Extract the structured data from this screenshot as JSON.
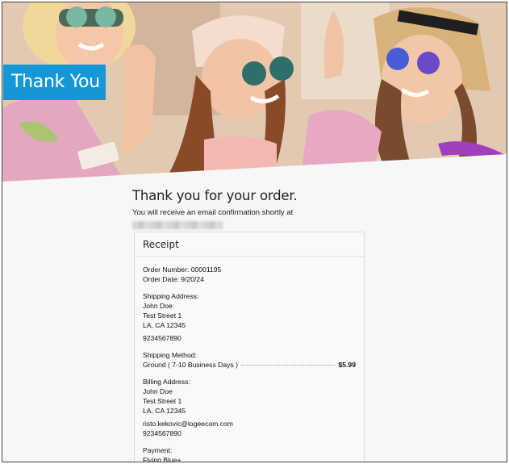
{
  "banner": {
    "title": "Thank You"
  },
  "confirmation": {
    "heading": "Thank you for your order.",
    "subtext": "You will receive an email confirmation shortly at"
  },
  "receipt": {
    "title": "Receipt",
    "order_number_label": "Order Number:",
    "order_number": "00001195",
    "order_date_label": "Order Date:",
    "order_date": "9/20/24",
    "shipping_address_label": "Shipping Address:",
    "shipping_address": [
      "John Doe",
      "Test Street 1",
      "LA, CA 12345"
    ],
    "shipping_phone": "9234567890",
    "shipping_method_label": "Shipping Method:",
    "shipping_method": "Ground ( 7-10 Business Days )",
    "shipping_price": "$5.99",
    "billing_address_label": "Billing Address:",
    "billing_address": [
      "John Doe",
      "Test Street 1",
      "LA, CA 12345"
    ],
    "billing_email": "risto.kekovic@logeecom.com",
    "billing_phone": "9234567890",
    "payment_label": "Payment:",
    "payment_method": "Flying Blue+"
  },
  "colors": {
    "banner_blue": "#1596d6",
    "page_bg": "#f7f7f7",
    "border": "#dcdcdc"
  }
}
